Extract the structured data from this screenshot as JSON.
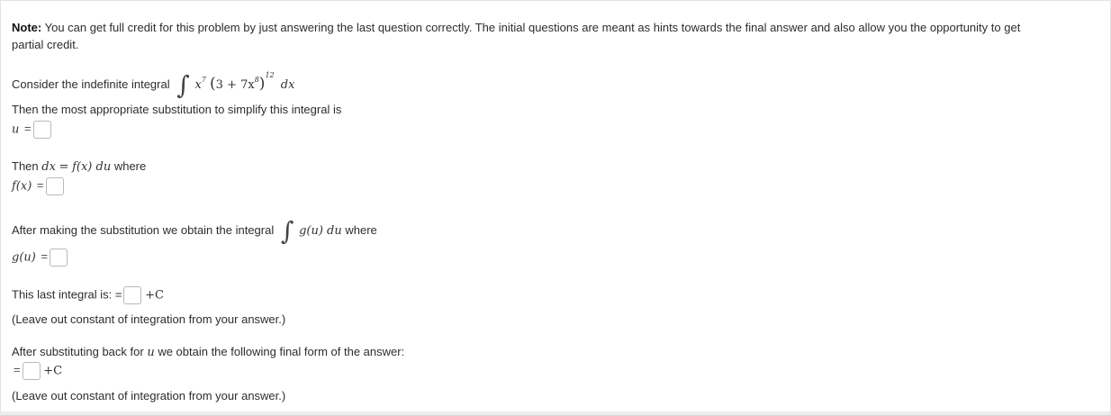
{
  "note": {
    "bold": "Note:",
    "line1": "You can get full credit for this problem by just answering the last question correctly. The initial questions are meant as hints towards the final answer and also allow you the opportunity to get",
    "line2": "partial credit."
  },
  "integral_prompt": {
    "text": "Consider the indefinite integral",
    "integrand_x": "x",
    "x_exp": "7",
    "open_paren": "(",
    "inner": "3 + 7x",
    "inner_exp": "8",
    "close_paren": ")",
    "outer_exp": "12",
    "dx": "dx"
  },
  "substitution_prompt": "Then the most appropriate substitution to simplify this integral is",
  "u_label": "u",
  "eq_sign": "=",
  "dx_line": {
    "then": "Then",
    "dx": "dx",
    "equals": "=",
    "fx": "f(x) du",
    "where": "where"
  },
  "fx_label": "f(x)",
  "after_sub": {
    "text": "After making the substitution we obtain the integral",
    "gu": "g(u) du",
    "where": "where"
  },
  "gu_label": "g(u)",
  "last_integral": {
    "text": "This last integral is: =",
    "plus_c": "+C"
  },
  "leave_out_1": "(Leave out constant of integration from your answer.)",
  "substitute_back": {
    "before": "After substituting back for",
    "u": "u",
    "after": "we obtain the following final form of the answer:"
  },
  "final_eq": "=",
  "final_plus_c": "+C",
  "leave_out_2": "(Leave out constant of integration from your answer.)"
}
